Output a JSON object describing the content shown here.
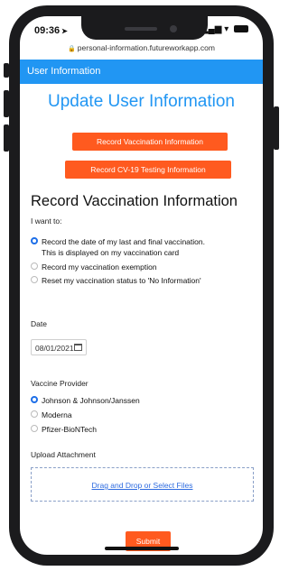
{
  "status_bar": {
    "time": "09:36",
    "location_icon": "location-arrow-icon",
    "signal_icon": "signal-icon",
    "wifi_icon": "wifi-icon",
    "battery_icon": "battery-icon"
  },
  "browser": {
    "url": "personal-information.futureworkapp.com",
    "lock_icon": "lock-icon"
  },
  "app_bar": {
    "title": "User Information",
    "color": "#2196f3"
  },
  "main": {
    "title": "Update User Information",
    "buttons": [
      {
        "label": "Record Vaccination Information"
      },
      {
        "label": "Record CV-19 Testing Information"
      }
    ],
    "section_title": "Record Vaccination Information",
    "intent": {
      "label": "I want to:",
      "options": [
        {
          "line1": "Record the date of my last and final vaccination.",
          "line2": "This is displayed on my vaccination card",
          "selected": true
        },
        {
          "line1": "Record my vaccination exemption",
          "selected": false
        },
        {
          "line1": "Reset my vaccination status to 'No Information'",
          "selected": false
        }
      ]
    },
    "date": {
      "label": "Date",
      "value": "08/01/2021",
      "icon": "calendar-icon"
    },
    "provider": {
      "label": "Vaccine Provider",
      "options": [
        {
          "label": "Johnson & Johnson/Janssen",
          "selected": true
        },
        {
          "label": "Moderna",
          "selected": false
        },
        {
          "label": "Pfizer-BioNTech",
          "selected": false
        }
      ]
    },
    "upload": {
      "label": "Upload Attachment",
      "link": "Drag and Drop or Select Files"
    },
    "submit_label": "Submit"
  },
  "colors": {
    "accent": "#2196f3",
    "button": "#ff5a1f",
    "radio_selected": "#1e6fe8"
  }
}
